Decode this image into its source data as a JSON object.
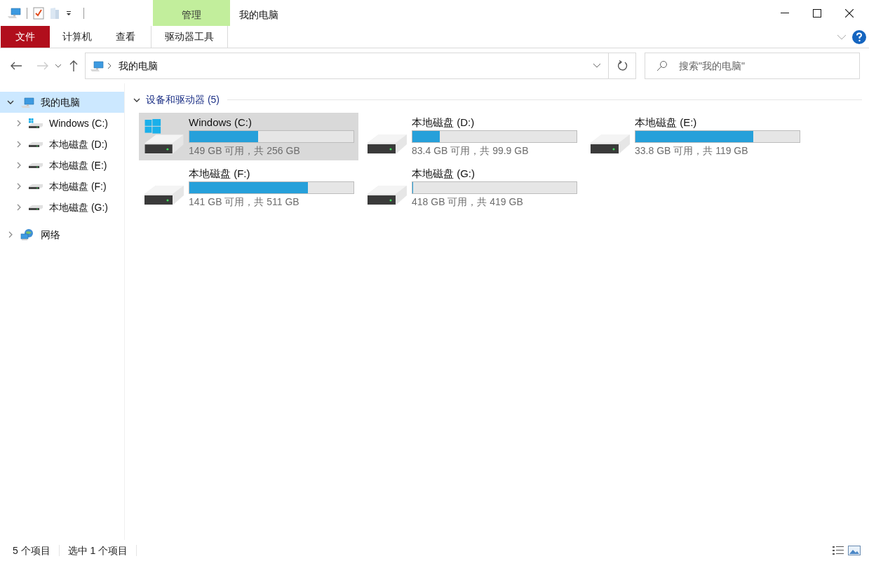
{
  "window": {
    "title": "我的电脑"
  },
  "ribbon": {
    "context_group": "管理",
    "tabs": [
      {
        "label": "文件",
        "kind": "file"
      },
      {
        "label": "计算机",
        "kind": "normal"
      },
      {
        "label": "查看",
        "kind": "normal"
      },
      {
        "label": "驱动器工具",
        "kind": "contextual"
      }
    ]
  },
  "address_bar": {
    "path": "我的电脑"
  },
  "search": {
    "placeholder": "搜索\"我的电脑\""
  },
  "sidebar": {
    "items": [
      {
        "label": "我的电脑",
        "kind": "computer",
        "expanded": true,
        "selected": true,
        "children": [
          {
            "label": "Windows (C:)",
            "kind": "system-drive",
            "expanded": false,
            "selected": false
          },
          {
            "label": "本地磁盘 (D:)",
            "kind": "drive",
            "expanded": false,
            "selected": false
          },
          {
            "label": "本地磁盘 (E:)",
            "kind": "drive",
            "expanded": false,
            "selected": false
          },
          {
            "label": "本地磁盘 (F:)",
            "kind": "drive",
            "expanded": false,
            "selected": false
          },
          {
            "label": "本地磁盘 (G:)",
            "kind": "drive",
            "expanded": false,
            "selected": false
          }
        ]
      },
      {
        "label": "网络",
        "kind": "network",
        "expanded": false,
        "selected": false
      }
    ]
  },
  "section": {
    "title": "设备和驱动器 (5)",
    "expanded": true,
    "drives": [
      {
        "name": "Windows (C:)",
        "kind": "system-drive",
        "level": 0.418,
        "space": "149 GB 可用，共 256 GB",
        "selected": true
      },
      {
        "name": "本地磁盘 (D:)",
        "kind": "drive",
        "level": 0.165,
        "space": "83.4 GB 可用，共 99.9 GB",
        "selected": false
      },
      {
        "name": "本地磁盘 (E:)",
        "kind": "drive",
        "level": 0.716,
        "space": "33.8 GB 可用，共 119 GB",
        "selected": false
      },
      {
        "name": "本地磁盘 (F:)",
        "kind": "drive",
        "level": 0.724,
        "space": "141 GB 可用，共 511 GB",
        "selected": false
      },
      {
        "name": "本地磁盘 (G:)",
        "kind": "drive",
        "level": 0.002,
        "space": "418 GB 可用，共 419 GB",
        "selected": false
      }
    ]
  },
  "status_bar": {
    "item_count": "5 个项目",
    "selection": "选中 1 个项目"
  }
}
